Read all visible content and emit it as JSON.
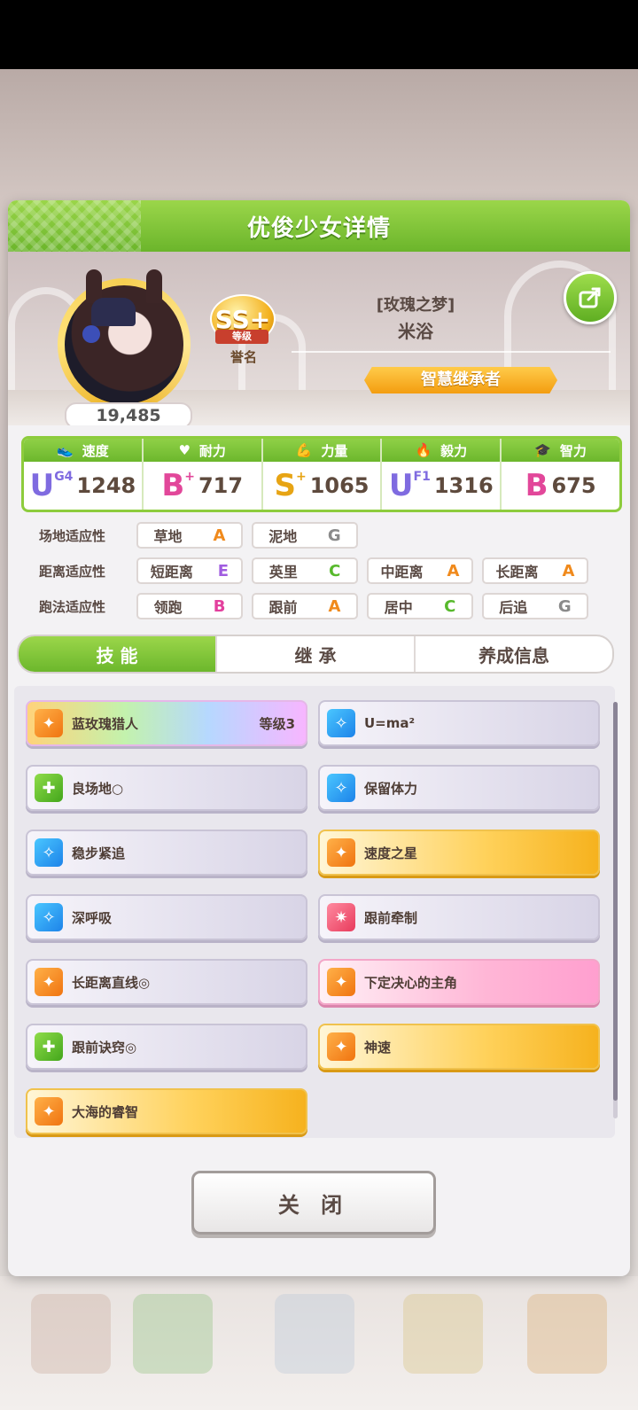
{
  "panel": {
    "title": "优俊少女详情"
  },
  "profile": {
    "fans": "19,485",
    "rank_badge": "SS+",
    "rank_ribbon": "等级",
    "rank_label": "誉名",
    "epithet": "[玫瑰之梦]",
    "name": "米浴",
    "title_tag": "智慧继承者"
  },
  "stats": [
    {
      "label": "速度",
      "icon": "shoe-icon",
      "grade": "U",
      "grade_sub": "G4",
      "value": "1248"
    },
    {
      "label": "耐力",
      "icon": "heart-icon",
      "grade": "B",
      "grade_sub": "+",
      "value": "717"
    },
    {
      "label": "力量",
      "icon": "muscle-icon",
      "grade": "S",
      "grade_sub": "+",
      "value": "1065"
    },
    {
      "label": "毅力",
      "icon": "flame-icon",
      "grade": "U",
      "grade_sub": "F1",
      "value": "1316"
    },
    {
      "label": "智力",
      "icon": "graduation-cap-icon",
      "grade": "B",
      "grade_sub": "",
      "value": "675"
    }
  ],
  "aptitude": {
    "track": {
      "label": "场地适应性",
      "items": [
        {
          "name": "草地",
          "grade": "A"
        },
        {
          "name": "泥地",
          "grade": "G"
        }
      ]
    },
    "distance": {
      "label": "距离适应性",
      "items": [
        {
          "name": "短距离",
          "grade": "E"
        },
        {
          "name": "英里",
          "grade": "C"
        },
        {
          "name": "中距离",
          "grade": "A"
        },
        {
          "name": "长距离",
          "grade": "A"
        }
      ]
    },
    "style": {
      "label": "跑法适应性",
      "items": [
        {
          "name": "领跑",
          "grade": "B"
        },
        {
          "name": "跟前",
          "grade": "A"
        },
        {
          "name": "居中",
          "grade": "C"
        },
        {
          "name": "后追",
          "grade": "G"
        }
      ]
    }
  },
  "tabs": [
    "技 能",
    "继 承",
    "养成信息"
  ],
  "skills": [
    {
      "name": "蓝玫瑰猎人",
      "level": "等级3",
      "style": "rainbow",
      "icon": "orange"
    },
    {
      "name": "U=ma²",
      "level": "",
      "style": "plain",
      "icon": "blue"
    },
    {
      "name": "良场地○",
      "level": "",
      "style": "plain",
      "icon": "green"
    },
    {
      "name": "保留体力",
      "level": "",
      "style": "plain",
      "icon": "blue"
    },
    {
      "name": "稳步紧追",
      "level": "",
      "style": "plain",
      "icon": "blue"
    },
    {
      "name": "速度之星",
      "level": "",
      "style": "gold",
      "icon": "orange"
    },
    {
      "name": "深呼吸",
      "level": "",
      "style": "plain",
      "icon": "blue"
    },
    {
      "name": "跟前牵制",
      "level": "",
      "style": "plain",
      "icon": "red"
    },
    {
      "name": "长距离直线◎",
      "level": "",
      "style": "plain",
      "icon": "orange"
    },
    {
      "name": "下定决心的主角",
      "level": "",
      "style": "pink",
      "icon": "orange"
    },
    {
      "name": "跟前诀窍◎",
      "level": "",
      "style": "plain",
      "icon": "green"
    },
    {
      "name": "神速",
      "level": "",
      "style": "gold",
      "icon": "orange"
    },
    {
      "name": "大海的睿智",
      "level": "",
      "style": "gold",
      "icon": "orange"
    }
  ],
  "close_label": "关 闭"
}
